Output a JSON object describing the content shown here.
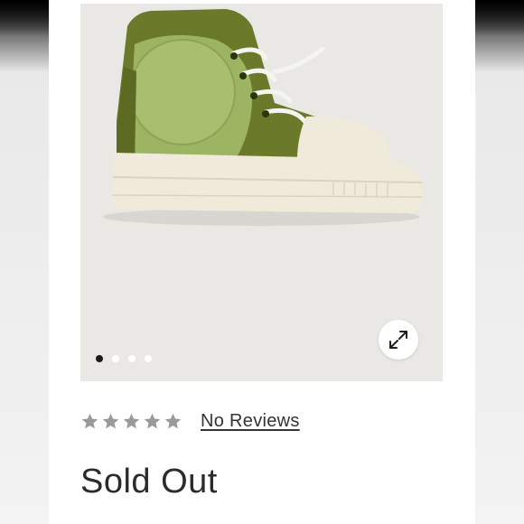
{
  "product": {
    "image_alt": "Green high-top platform sneaker",
    "gallery": {
      "slide_count": 4,
      "active_slide": 0
    },
    "expand_icon": "expand-arrows-icon",
    "rating": {
      "stars_filled": 0,
      "stars_total": 5,
      "reviews_label": "No Reviews"
    },
    "status_label": "Sold Out"
  },
  "colors": {
    "image_background": "#e9e8e5",
    "shoe_dark_green": "#6b7a2a",
    "shoe_light_green": "#9db562",
    "sole_cream": "#efeada",
    "star_empty": "#9a9a9a"
  }
}
